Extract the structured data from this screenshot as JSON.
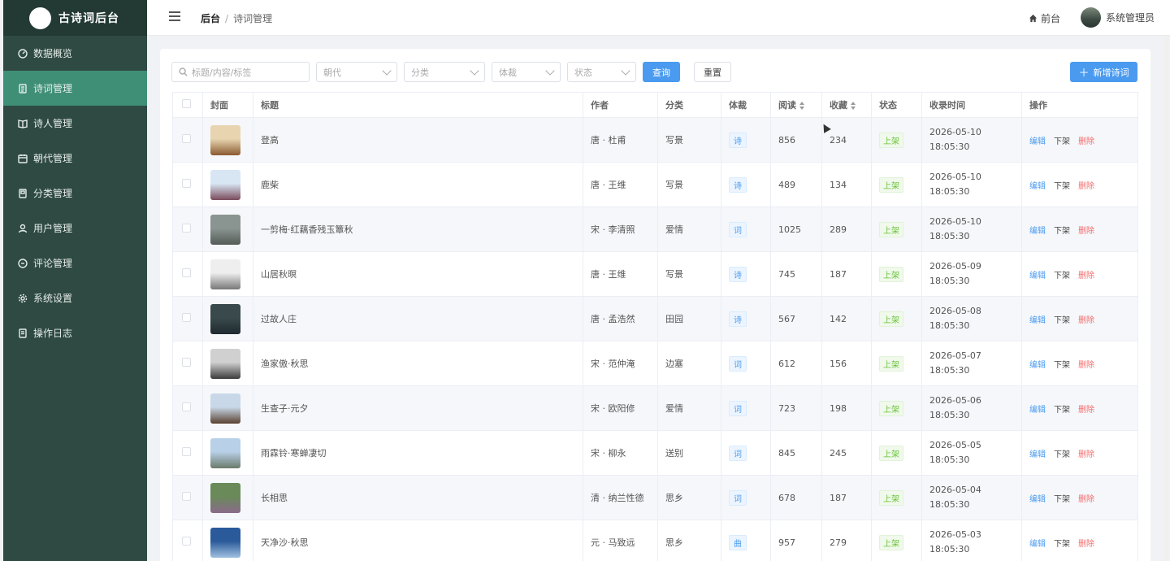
{
  "app": {
    "title": "古诗词后台"
  },
  "sidebar": {
    "items": [
      {
        "label": "数据概览",
        "icon": "dashboard-icon",
        "active": false
      },
      {
        "label": "诗词管理",
        "icon": "document-icon",
        "active": true
      },
      {
        "label": "诗人管理",
        "icon": "book-icon",
        "active": false
      },
      {
        "label": "朝代管理",
        "icon": "calendar-icon",
        "active": false
      },
      {
        "label": "分类管理",
        "icon": "folder-icon",
        "active": false
      },
      {
        "label": "用户管理",
        "icon": "user-icon",
        "active": false
      },
      {
        "label": "评论管理",
        "icon": "comment-icon",
        "active": false
      },
      {
        "label": "系统设置",
        "icon": "gear-icon",
        "active": false
      },
      {
        "label": "操作日志",
        "icon": "log-icon",
        "active": false
      }
    ]
  },
  "header": {
    "breadcrumb_home": "后台",
    "breadcrumb_sep": "/",
    "breadcrumb_current": "诗词管理",
    "front_link": "前台",
    "user_name": "系统管理员"
  },
  "filters": {
    "search_placeholder": "标题/内容/标签",
    "dynasty_placeholder": "朝代",
    "category_placeholder": "分类",
    "genre_placeholder": "体裁",
    "status_placeholder": "状态",
    "query_label": "查询",
    "reset_label": "重置",
    "add_label": "新增诗词"
  },
  "table": {
    "headers": {
      "cover": "封面",
      "title": "标题",
      "author": "作者",
      "category": "分类",
      "genre": "体裁",
      "views": "阅读",
      "favorites": "收藏",
      "status": "状态",
      "time": "收录时间",
      "ops": "操作"
    },
    "op_labels": {
      "edit": "编辑",
      "off": "下架",
      "delete": "删除"
    },
    "rows": [
      {
        "title": "登高",
        "author": "唐 · 杜甫",
        "category": "写景",
        "genre": "诗",
        "views": "856",
        "favorites": "234",
        "status": "上架",
        "date": "2026-05-10",
        "time": "18:05:30",
        "cover": [
          "#e8d5b0",
          "#8a5a30"
        ]
      },
      {
        "title": "鹿柴",
        "author": "唐 · 王维",
        "category": "写景",
        "genre": "诗",
        "views": "489",
        "favorites": "134",
        "status": "上架",
        "date": "2026-05-10",
        "time": "18:05:30",
        "cover": [
          "#d8e6f4",
          "#7a4a5a"
        ]
      },
      {
        "title": "一剪梅·红藕香残玉簟秋",
        "author": "宋 · 李清照",
        "category": "爱情",
        "genre": "词",
        "views": "1025",
        "favorites": "289",
        "status": "上架",
        "date": "2026-05-10",
        "time": "18:05:30",
        "cover": [
          "#8a9490",
          "#555c58"
        ]
      },
      {
        "title": "山居秋暝",
        "author": "唐 · 王维",
        "category": "写景",
        "genre": "诗",
        "views": "745",
        "favorites": "187",
        "status": "上架",
        "date": "2026-05-09",
        "time": "18:05:30",
        "cover": [
          "#eeeeee",
          "#777777"
        ]
      },
      {
        "title": "过故人庄",
        "author": "唐 · 孟浩然",
        "category": "田园",
        "genre": "诗",
        "views": "567",
        "favorites": "142",
        "status": "上架",
        "date": "2026-05-08",
        "time": "18:05:30",
        "cover": [
          "#3a4a4c",
          "#1e2a30"
        ]
      },
      {
        "title": "渔家傲·秋思",
        "author": "宋 · 范仲淹",
        "category": "边塞",
        "genre": "词",
        "views": "612",
        "favorites": "156",
        "status": "上架",
        "date": "2026-05-07",
        "time": "18:05:30",
        "cover": [
          "#d0d0d0",
          "#3a3a3a"
        ]
      },
      {
        "title": "生查子·元夕",
        "author": "宋 · 欧阳修",
        "category": "爱情",
        "genre": "词",
        "views": "723",
        "favorites": "198",
        "status": "上架",
        "date": "2026-05-06",
        "time": "18:05:30",
        "cover": [
          "#c8d8e8",
          "#5a4030"
        ]
      },
      {
        "title": "雨霖铃·寒蝉凄切",
        "author": "宋 · 柳永",
        "category": "送别",
        "genre": "词",
        "views": "845",
        "favorites": "245",
        "status": "上架",
        "date": "2026-05-05",
        "time": "18:05:30",
        "cover": [
          "#b8d0e8",
          "#6a7a6a"
        ]
      },
      {
        "title": "长相思",
        "author": "清 · 纳兰性德",
        "category": "思乡",
        "genre": "词",
        "views": "678",
        "favorites": "187",
        "status": "上架",
        "date": "2026-05-04",
        "time": "18:05:30",
        "cover": [
          "#6a8a5a",
          "#8a6a8a"
        ]
      },
      {
        "title": "天净沙·秋思",
        "author": "元 · 马致远",
        "category": "思乡",
        "genre": "曲",
        "views": "957",
        "favorites": "279",
        "status": "上架",
        "date": "2026-05-03",
        "time": "18:05:30",
        "cover": [
          "#2a5a9a",
          "#a0c0e0"
        ]
      }
    ]
  }
}
